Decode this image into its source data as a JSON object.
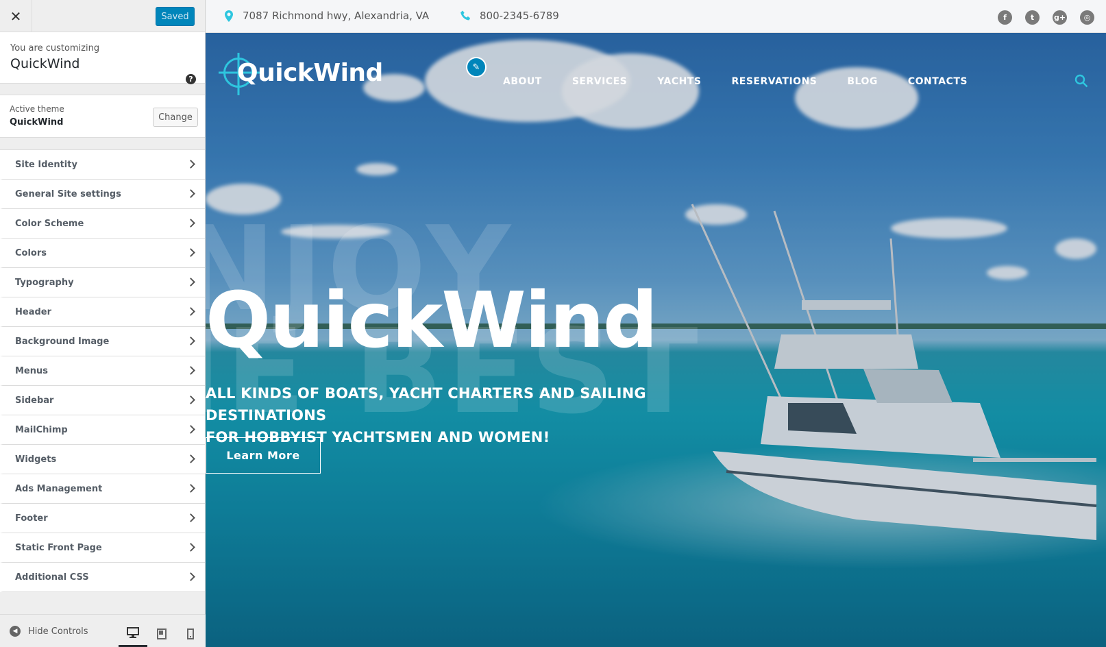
{
  "sidebar": {
    "close_label": "✕",
    "saved_label": "Saved",
    "customizing_label": "You are customizing",
    "customizing_title": "QuickWind",
    "help_label": "?",
    "active_theme_label": "Active theme",
    "active_theme_name": "QuickWind",
    "change_label": "Change",
    "sections": [
      "Site Identity",
      "General Site settings",
      "Color Scheme",
      "Colors",
      "Typography",
      "Header",
      "Background Image",
      "Menus",
      "Sidebar",
      "MailChimp",
      "Widgets",
      "Ads Management",
      "Footer",
      "Static Front Page",
      "Additional CSS"
    ],
    "hide_controls_label": "Hide Controls",
    "devices": [
      "desktop-icon",
      "tablet-icon",
      "mobile-icon"
    ],
    "active_device": "desktop"
  },
  "topbar": {
    "address": "7087 Richmond hwy, Alexandria, VA",
    "phone": "800-2345-6789",
    "social": [
      {
        "name": "facebook-icon",
        "glyph": "f"
      },
      {
        "name": "twitter-icon",
        "glyph": "t"
      },
      {
        "name": "google-plus-icon",
        "glyph": "g+"
      },
      {
        "name": "instagram-icon",
        "glyph": "◎"
      }
    ]
  },
  "site": {
    "logo_text": "QuickWind",
    "nav": [
      "ABOUT",
      "SERVICES",
      "YACHTS",
      "RESERVATIONS",
      "BLOG",
      "CONTACTS"
    ],
    "hero_title": "QuickWind",
    "hero_subtitle_line1": "ALL KINDS OF BOATS, YACHT CHARTERS AND SAILING DESTINATIONS",
    "hero_subtitle_line2": "FOR HOBBYIST YACHTSMEN AND WOMEN!",
    "cta_label": "Learn More",
    "ghost_line1": "NJOY",
    "ghost_line2": "IE BEST"
  },
  "colors": {
    "accent": "#2ec6df",
    "wp_blue": "#0085ba",
    "sidebar_bg": "#eeeeee"
  }
}
